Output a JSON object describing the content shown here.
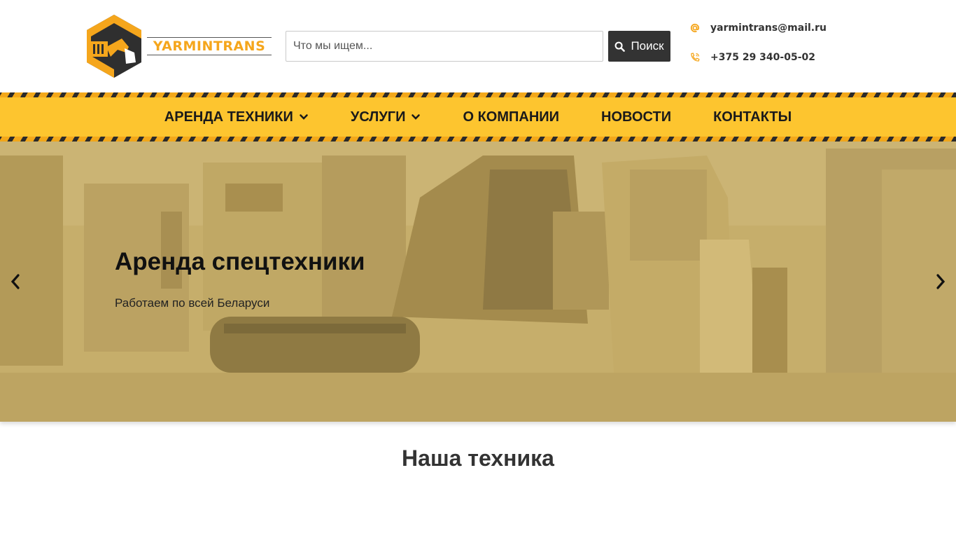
{
  "brand": {
    "logo_text": "YARMINTRANS",
    "accent_color": "#f5a61c"
  },
  "search": {
    "placeholder": "Что мы ищем...",
    "button_label": "Поиск"
  },
  "contacts": {
    "email": "yarmintrans@mail.ru",
    "phone": "+375 29 340-05-02"
  },
  "nav": {
    "items": [
      {
        "label": "АРЕНДА ТЕХНИКИ",
        "has_dropdown": true
      },
      {
        "label": "УСЛУГИ",
        "has_dropdown": true
      },
      {
        "label": "О КОМПАНИИ",
        "has_dropdown": false
      },
      {
        "label": "НОВОСТИ",
        "has_dropdown": false
      },
      {
        "label": "КОНТАКТЫ",
        "has_dropdown": false
      }
    ],
    "bar_color": "#fdc52f"
  },
  "hero": {
    "title": "Аренда спецтехники",
    "subtitle": "Работаем по всей Беларуси"
  },
  "section": {
    "title": "Наша техника"
  }
}
